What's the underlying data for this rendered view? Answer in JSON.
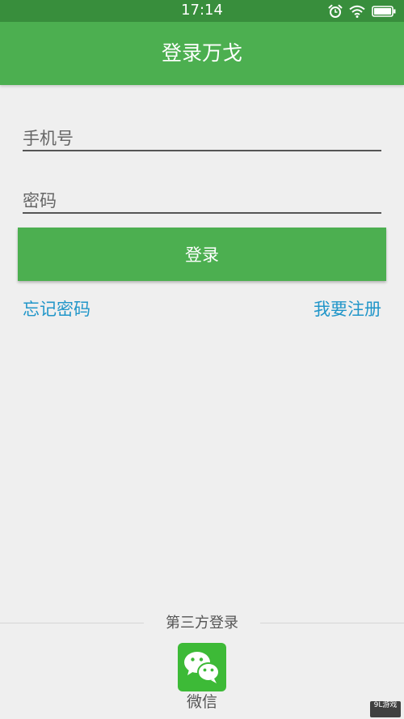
{
  "status_bar": {
    "time": "17:14",
    "icons": [
      "alarm-icon",
      "wifi-icon",
      "battery-icon"
    ]
  },
  "app_bar": {
    "title": "登录万戈"
  },
  "form": {
    "phone_placeholder": "手机号",
    "password_placeholder": "密码",
    "login_label": "登录"
  },
  "links": {
    "forgot_password": "忘记密码",
    "register": "我要注册"
  },
  "third_party": {
    "label": "第三方登录",
    "wechat_label": "微信",
    "wechat_icon": "wechat-icon"
  },
  "watermark": {
    "text": "9L游戏"
  },
  "colors": {
    "primary": "#4caf50",
    "primary_dark": "#388e3c",
    "link": "#2196c9",
    "background": "#efefef",
    "wechat": "#3dba37"
  }
}
